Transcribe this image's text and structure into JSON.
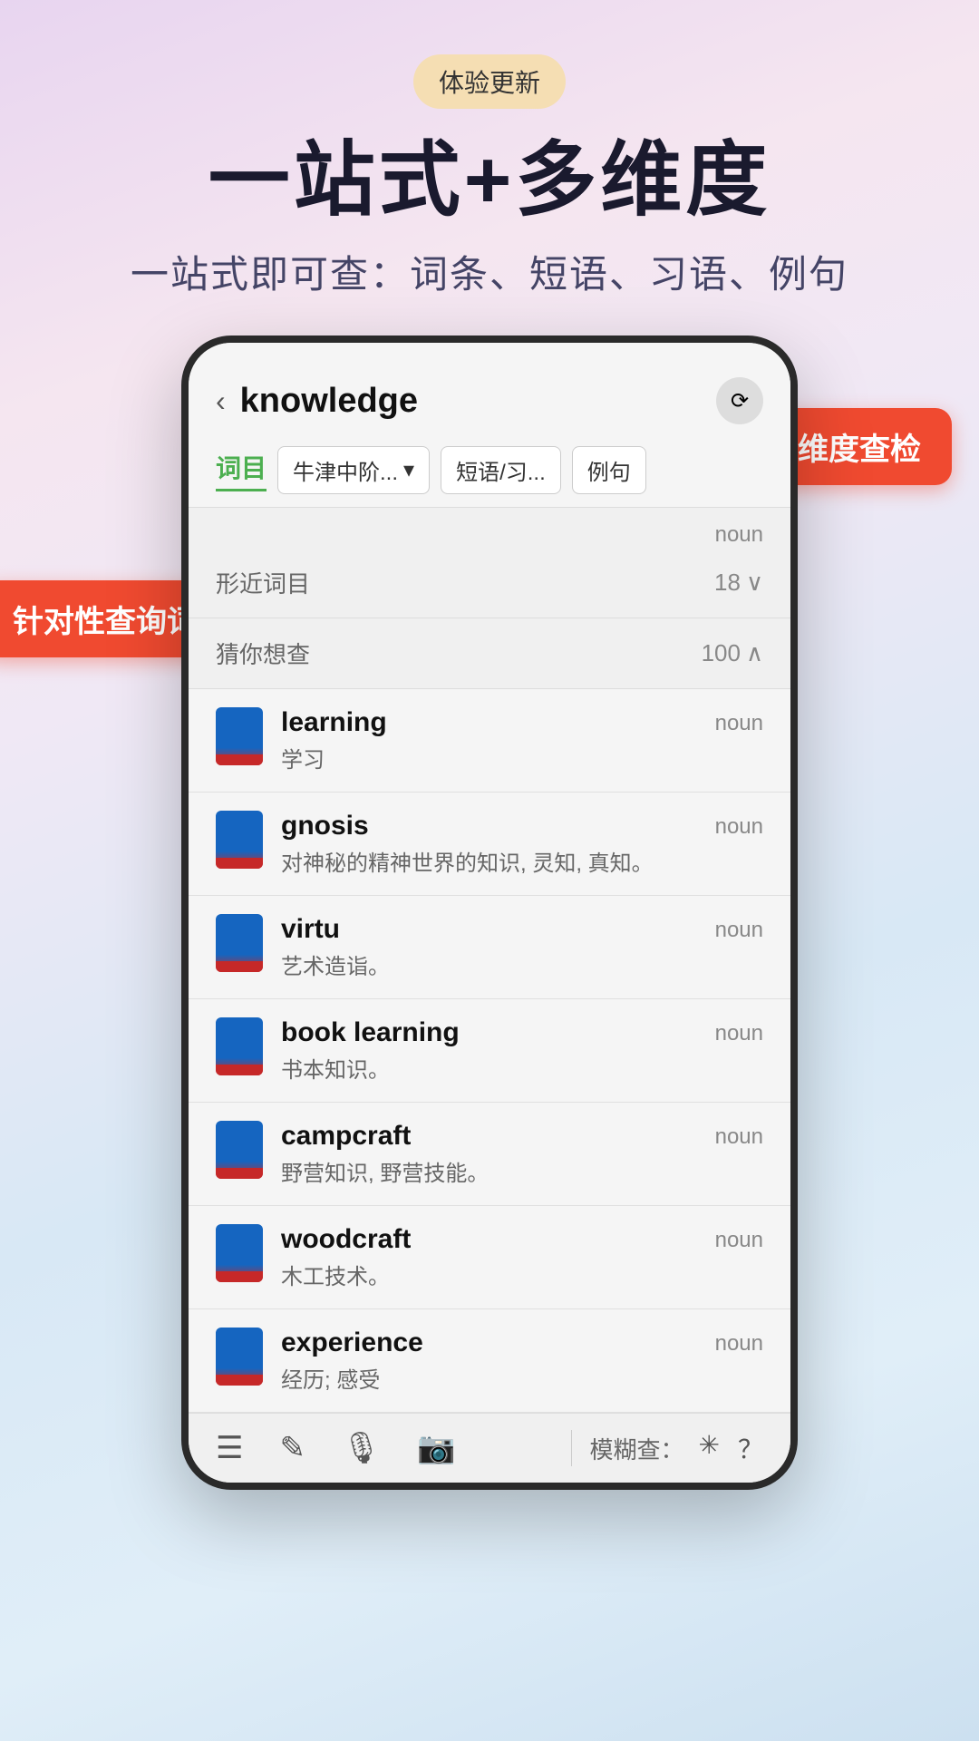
{
  "badge": {
    "text": "体验更新"
  },
  "hero": {
    "title": "一站式+多维度",
    "subtitle": "一站式即可查：词条、短语、习语、例句"
  },
  "tooltips": {
    "multidim": "多维度查检",
    "query": "针对性查询词典"
  },
  "phone": {
    "search_word": "knowledge",
    "back_icon": "‹",
    "tabs": {
      "word_list": "词目",
      "dictionary_dropdown": "牛津中阶...",
      "phrase": "短语/习...",
      "example": "例句"
    },
    "similar_section": {
      "label": "形近词目",
      "count": "18",
      "icon": "∨"
    },
    "suggest_section": {
      "label": "猜你想查",
      "count": "100",
      "icon": "∧"
    },
    "first_noun": "noun",
    "words": [
      {
        "english": "learning",
        "chinese": "学习",
        "pos": "noun"
      },
      {
        "english": "gnosis",
        "chinese": "对神秘的精神世界的知识, 灵知, 真知。",
        "pos": "noun"
      },
      {
        "english": "virtu",
        "chinese": "艺术造诣。",
        "pos": "noun"
      },
      {
        "english": "book learning",
        "chinese": "书本知识。",
        "pos": "noun"
      },
      {
        "english": "campcraft",
        "chinese": "野营知识, 野营技能。",
        "pos": "noun"
      },
      {
        "english": "woodcraft",
        "chinese": "木工技术。",
        "pos": "noun"
      },
      {
        "english": "experience",
        "chinese": "经历; 感受",
        "pos": "noun"
      }
    ],
    "bottom_bar": {
      "icons": [
        "☰",
        "✎",
        "🎙",
        "📷"
      ],
      "fuzzy_label": "模糊查：",
      "fuzzy_icons": [
        "✳",
        "？"
      ]
    }
  }
}
